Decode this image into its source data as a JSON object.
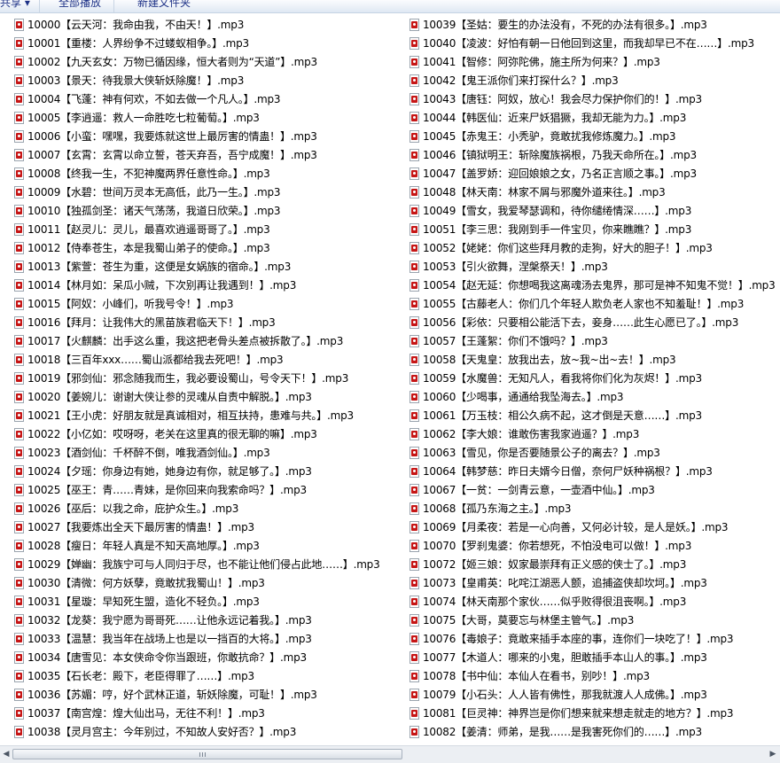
{
  "toolbar": {
    "share": "共享 ▾",
    "play_all": "全部播放",
    "new_folder": "新建文件夹"
  },
  "icons": {
    "file": "mp3-file-icon"
  },
  "left_files": [
    "10000【云天河：我命由我，不由天！】.mp3",
    "10001【重楼：人界纷争不过蝼蚁相争。】.mp3",
    "10002【九天玄女：万物已循因缘，恒大者则为“天道”】.mp3",
    "10003【景天：待我景大侠斩妖除魔！】.mp3",
    "10004【飞蓬：神有何欢，不如去做一个凡人。】.mp3",
    "10005【李逍遥：救人一命胜吃七粒葡萄。】.mp3",
    "10006【小蛮：嘿嘿，我要炼就这世上最厉害的情蛊！】.mp3",
    "10007【玄霄：玄霄以命立誓，苍天弃吾，吾宁成魔！】.mp3",
    "10008【终我一生，不犯神魔两界任意性命。】.mp3",
    "10009【水碧：世间万灵本无高低，此乃一生。】.mp3",
    "10010【独孤剑圣：诸天气荡荡，我道日欣荣。】.mp3",
    "10011【赵灵儿：灵儿，最喜欢逍遥哥哥了。】.mp3",
    "10012【侍奉苍生，本是我蜀山弟子的使命。】.mp3",
    "10013【紫萱：苍生为重，这便是女娲族的宿命。】.mp3",
    "10014【林月如：呆瓜小贼，下次别再让我遇到！】.mp3",
    "10015【阿奴：小峰们，听我号令！】.mp3",
    "10016【拜月：让我伟大的黑苗族君临天下！】.mp3",
    "10017【火麒麟：出手这么重，我这把老骨头差点被拆散了。】.mp3",
    "10018【三百年xxx……蜀山派都给我去死吧！】.mp3",
    "10019【邪剑仙：邪念随我而生，我必要设蜀山，号令天下！】.mp3",
    "10020【姜婉儿：谢谢大侠让参的灵魂从自责中解脱。】.mp3",
    "10021【王小虎：好朋友就是真诚相对，相互扶持，患难与共。】.mp3",
    "10022【小亿如：哎呀呀，老关在这里真的很无聊的嘛】.mp3",
    "10023【酒剑仙：千杯醉不倒，唯我酒剑仙。】.mp3",
    "10024【夕瑶：你身边有她，她身边有你，就足够了。】.mp3",
    "10025【巫王：青……青妹，是你回来向我索命吗？】.mp3",
    "10026【巫后：以我之命，庇护众生。】.mp3",
    "10027【我要炼出全天下最厉害的情蛊！】.mp3",
    "10028【瘦日：年轻人真是不知天高地厚。】.mp3",
    "10029【婵幽：我族宁可与人同归于尽，也不能让他们侵占此地……】.mp3",
    "10030【清微：何方妖孽，竟敢扰我蜀山！】.mp3",
    "10031【星璇：早知死生盟，造化不轻负。】.mp3",
    "10032【龙葵：我宁愿为哥哥死……让他永远记着我。】.mp3",
    "10033【温慧：我当年在战场上也是以一挡百的大将。】.mp3",
    "10034【唐雪见：本女侠命令你当跟班，你敢抗命？】.mp3",
    "10035【石长老：殿下，老臣得罪了……】.mp3",
    "10036【苏媚：哼，好个武林正道，斩妖除魔，可耻！】.mp3",
    "10037【南宫煌：煌大仙出马，无往不利！】.mp3",
    "10038【灵月宫主：今年别过，不知故人安好否？】.mp3"
  ],
  "right_files": [
    "10039【圣姑：要生的办法没有，不死的办法有很多。】.mp3",
    "10040【凌波：好怕有朝一日他回到这里，而我却早已不在……】.mp3",
    "10041【智修：阿弥陀佛，施主所为何来？】.mp3",
    "10042【鬼王派你们来打探什么？】.mp3",
    "10043【唐钰：阿奴，放心！我会尽力保护你们的！】.mp3",
    "10044【韩医仙：近来尸妖猖獗，我却无能为力。】.mp3",
    "10045【赤鬼王：小秃驴，竟敢扰我修炼魔力。】.mp3",
    "10046【镇狱明王：斩除魔族祸根，乃我天命所在。】.mp3",
    "10047【盖罗娇：迎回娘娘之女，乃名正言顺之事。】.mp3",
    "10048【林天南：林家不屑与邪魔外道来往。】.mp3",
    "10049【雪女，我爱琴瑟调和，待你缱绻情深……】.mp3",
    "10051【李三思：我刚到手一件宝贝，你来瞧瞧？】.mp3",
    "10052【姥姥：你们这些拜月教的走狗，好大的胆子！】.mp3",
    "10053【引火欲舞，涅槃祭天！】.mp3",
    "10054【赵无延：你想喝我这离魂汤去鬼界，那可是神不知鬼不觉！】.mp3",
    "10055【古藤老人：你们几个年轻人欺负老人家也不知羞耻！】.mp3",
    "10056【彩依：只要相公能活下去，妾身……此生心愿已了。】.mp3",
    "10057【王蓬絮：你们不饿吗？】.mp3",
    "10058【天鬼皇：放我出去，放~我~出~去！】.mp3",
    "10059【水魔兽：无知凡人，看我将你们化为灰烬！】.mp3",
    "10060【少喝事，通通给我坠海去。】.mp3",
    "10061【万玉枝：相公久病不起，这才倒是天意……】.mp3",
    "10062【李大娘：谁敢伤害我家逍遥？】.mp3",
    "10063【雪见，你是否要随景公子的离去？】.mp3",
    "10064【韩梦慈：昨日夫婿今日僧，奈何尸妖种祸根？】.mp3",
    "10067【一贫：一剑青云意，一壶酒中仙。】.mp3",
    "10068【孤乃东海之主。】.mp3",
    "10069【月柔夜：若是一心向善，又何必计较，是人是妖。】.mp3",
    "10070【罗刹鬼婆：你若想死，不怕没电可以做！】.mp3",
    "10072【姬三娘：奴家最崇拜有正义感的侠士了。】.mp3",
    "10073【皇甫英：叱咤江湖恶人颤，追捕盗侠却坎坷。】.mp3",
    "10074【林天南那个家伙……似乎败得很沮丧啊。】.mp3",
    "10075【大哥，莫要忘与林堡主管气。】.mp3",
    "10076【毒娘子：竟敢来插手本座的事，连你们一块吃了！】.mp3",
    "10077【木道人：哪来的小鬼，胆敢插手本山人的事。】.mp3",
    "10078【书中仙：本仙人在看书，别吵！】.mp3",
    "10079【小石头：人人皆有佛性，那我就渡人人成佛。】.mp3",
    "10081【巨灵神：神界岂是你们想来就来想走就走的地方？】.mp3",
    "10082【姜清：师弟，是我……是我害死你们的……】.mp3"
  ],
  "scrollbar": {
    "left_arrow": "◀",
    "right_arrow": "▶"
  }
}
